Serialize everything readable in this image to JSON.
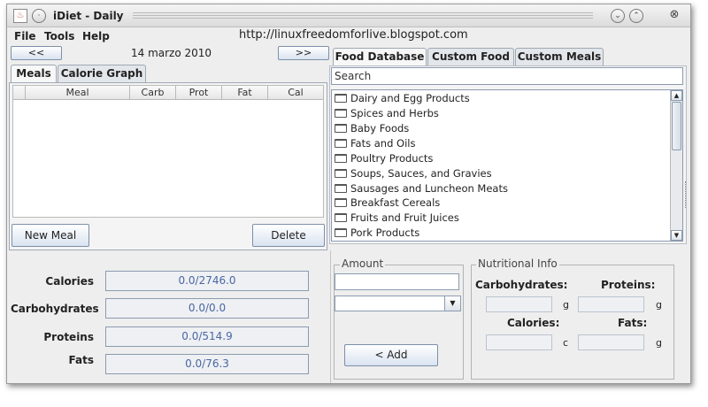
{
  "window": {
    "title": "iDiet - Daily"
  },
  "menu": {
    "items": [
      "File",
      "Tools",
      "Help"
    ],
    "url": "http://linuxfreedomforlive.blogspot.com"
  },
  "date_nav": {
    "prev_label": "<<",
    "next_label": ">>",
    "date": "14 marzo 2010"
  },
  "left_tabs": [
    "Meals",
    "Calorie Graph"
  ],
  "meals_table": {
    "columns": [
      "Meal",
      "Carb",
      "Prot",
      "Fat",
      "Cal"
    ]
  },
  "meal_buttons": {
    "new_label": "New Meal",
    "delete_label": "Delete"
  },
  "totals": [
    {
      "label": "Calories",
      "value": "0.0/2746.0"
    },
    {
      "label": "Carbohydrates",
      "value": "0.0/0.0"
    },
    {
      "label": "Proteins",
      "value": "0.0/514.9"
    },
    {
      "label": "Fats",
      "value": "0.0/76.3"
    }
  ],
  "right_tabs": [
    "Food Database",
    "Custom Food",
    "Custom Meals"
  ],
  "search": {
    "placeholder": "Search"
  },
  "food_categories": [
    "Dairy and Egg Products",
    "Spices and Herbs",
    "Baby Foods",
    "Fats and Oils",
    "Poultry Products",
    "Soups, Sauces, and Gravies",
    "Sausages and Luncheon Meats",
    "Breakfast Cereals",
    "Fruits and Fruit Juices",
    "Pork Products"
  ],
  "amount": {
    "title": "Amount",
    "add_label": "< Add"
  },
  "nutritional_info": {
    "title": "Nutritional Info",
    "carbohydrates_label": "Carbohydrates:",
    "proteins_label": "Proteins:",
    "calories_label": "Calories:",
    "fats_label": "Fats:",
    "unit_g": "g",
    "unit_c": "c"
  },
  "colors": {
    "value_text": "#4a66a3",
    "button_gradient_end": "#d9e3f0"
  }
}
